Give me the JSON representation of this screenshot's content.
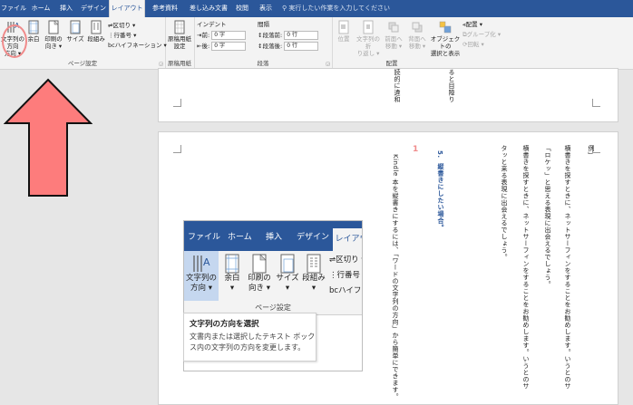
{
  "tabs": [
    "ファイル",
    "ホーム",
    "挿入",
    "デザイン",
    "レイアウト",
    "参考資料",
    "差し込み文書",
    "校閲",
    "表示"
  ],
  "active_tab": "レイアウト",
  "tell_me": "実行したい作業を入力してください",
  "ribbon": {
    "page_setup": {
      "label": "ページ設定",
      "text_direction": "文字列の方向",
      "text_direction_2": "方向 ▾",
      "margins": "余白",
      "orientation": "印刷の",
      "orientation_2": "向き ▾",
      "size": "サイズ",
      "columns": "段組み",
      "breaks": "区切り ▾",
      "line_numbers": "行番号 ▾",
      "hyphenation": "ハイフネーション ▾"
    },
    "manuscript": {
      "label": "原稿用紙",
      "button": "原稿用紙",
      "button_2": "設定"
    },
    "paragraph": {
      "label": "段落",
      "indent": "インデント",
      "spacing": "間隔",
      "before_label": "前:",
      "before_value": "0 字",
      "after_label": "後:",
      "after_value": "0 字",
      "space_before_label": "段落前:",
      "space_before_value": "0 行",
      "space_after_label": "段落後:",
      "space_after_value": "0 行"
    },
    "arrange": {
      "label": "配置",
      "position": "位置",
      "wrap": "文字列の折",
      "wrap_2": "り返し ▾",
      "forward": "前面へ",
      "forward_2": "移動 ▾",
      "backward": "背面へ",
      "backward_2": "移動 ▾",
      "selection_pane": "オブジェクトの",
      "selection_pane_2": "選択と表示",
      "align": "配置 ▾",
      "group": "グループ化 ▾",
      "rotate": "回転 ▾"
    }
  },
  "document": {
    "page1_text1": "読的に違和",
    "page1_text2": "ると目障り",
    "page2_col1": "例」",
    "page2_col2": "横書きを探すときに、ネットサーフィンをすることをお勧めします。いうとのサイトを見てみると分",
    "page2_col3": "「ロケッ」と思える表現に出会えるでしょう。",
    "page2_col4": "横書きを探すときに、ネットサーフィンをすることをお勧めします。いうとのサイトを見てみると分",
    "page2_col5": "タッと来る表現に出会えるでしょう。",
    "heading_num": "5.",
    "heading": "縦書きにしたい場合。",
    "body": "Kindle 本を縦書きにするには、「ワードの文字列の方向」から簡単にできます。",
    "highlight_num": "1"
  },
  "screenshot": {
    "tabs": [
      "ファイル",
      "ホーム",
      "挿入",
      "デザイン",
      "レイアウト"
    ],
    "text_direction": "文字列の",
    "text_direction_2": "方向 ▾",
    "margins": "余白",
    "margins_2": "▾",
    "orientation": "印刷の",
    "orientation_2": "向き ▾",
    "size": "サイズ",
    "size_2": "▾",
    "columns": "段組み",
    "columns_2": "▾",
    "breaks": "区切り ▾",
    "line_numbers": "行番号 ▾",
    "hyphenation": "ハイフネーション",
    "group_label": "ページ設定"
  },
  "tooltip": {
    "title": "文字列の方向を選択",
    "desc1": "文書内または選択したテキスト ボック",
    "desc2": "ス内の文字列の方向を変更します。"
  },
  "colors": {
    "ribbon_blue": "#2b579a",
    "arrow": "#fd7c7c"
  }
}
